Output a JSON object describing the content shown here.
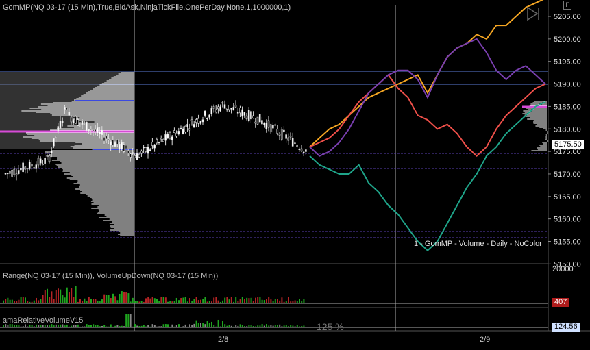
{
  "header": {
    "chart_title": "GomMP(NQ 03-17 (15 Min),True,BidAsk,NinjaTickFile,OnePerDay,None,1,1000000,1)",
    "profile_legend": "1 - GomMP - Volume - Daily - NoColor",
    "corner_button": "F"
  },
  "price_axis": {
    "ticks": [
      "5205.00",
      "5200.00",
      "5195.00",
      "5190.00",
      "5185.00",
      "5180.00",
      "5175.00",
      "5170.00",
      "5165.00",
      "5160.00",
      "5155.00",
      "5150.00"
    ],
    "last_price": "5175.50"
  },
  "panel2": {
    "title": "Range(NQ 03-17 (15 Min)), VolumeUpDown(NQ 03-17 (15 Min))",
    "axis_tick": "20000",
    "value_badge": "407"
  },
  "panel3": {
    "title": "amaRelativeVolumeV15",
    "overlay_text": "125 %",
    "value_badge": "124.56"
  },
  "time_axis": {
    "labels": [
      "2/8",
      "2/9"
    ]
  },
  "colors": {
    "orange": "#f5a623",
    "red": "#f0504a",
    "purple": "#7a3fb0",
    "teal": "#1fa58a",
    "magenta": "#d64bd6",
    "blue": "#3b49e0",
    "up_bar": "#1fa51f",
    "down_bar": "#b52424"
  },
  "chart_data": [
    {
      "type": "line",
      "title": "GomMP(NQ 03-17 (15 Min),True,BidAsk,NinjaTickFile,OnePerDay,None,1,1000000,1)",
      "ylim": [
        5149,
        5209
      ],
      "series": [
        {
          "values": [
            5176,
            5178,
            5180,
            5181,
            5183,
            5185,
            5187,
            5188,
            5189,
            5190,
            5191,
            5192,
            5188,
            5192,
            5196,
            5198,
            5199,
            5201,
            5200,
            5203,
            5203,
            5205,
            5207,
            5208,
            5209
          ]
        },
        {
          "values": [
            5176,
            5177,
            5178,
            5180,
            5183,
            5186,
            5188,
            5190,
            5192,
            5189,
            5187,
            5183,
            5182,
            5180,
            5181,
            5179,
            5176,
            5174,
            5176,
            5180,
            5183,
            5185,
            5187,
            5189,
            5190
          ]
        },
        {
          "values": [
            5176,
            5174,
            5175,
            5177,
            5180,
            5184,
            5188,
            5190,
            5192,
            5193,
            5193,
            5191,
            5187,
            5192,
            5196,
            5198,
            5199,
            5200,
            5197,
            5193,
            5191,
            5193,
            5194,
            5192,
            5190
          ]
        },
        {
          "values": [
            5174,
            5172,
            5171,
            5170,
            5170,
            5172,
            5168,
            5166,
            5163,
            5161,
            5158,
            5155,
            5153,
            5155,
            5159,
            5163,
            5167,
            5170,
            5174,
            5176,
            5179,
            5181,
            5183,
            5185,
            5186
          ]
        }
      ]
    }
  ]
}
